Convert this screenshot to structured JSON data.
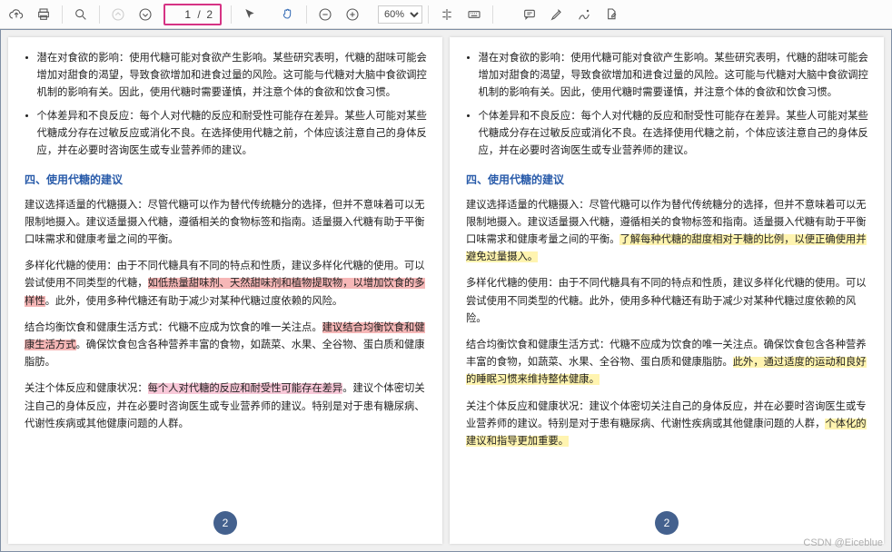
{
  "toolbar": {
    "page_current": "1",
    "page_total": " /  2",
    "zoom_value": "60%"
  },
  "watermark": "CSDN @Eiceblue",
  "page_number_badge": "2",
  "shared": {
    "bullet1": "潜在对食欲的影响：使用代糖可能对食欲产生影响。某些研究表明，代糖的甜味可能会增加对甜食的渴望，导致食欲增加和进食过量的风险。这可能与代糖对大脑中食欲调控机制的影响有关。因此，使用代糖时需要谨慎，并注意个体的食欲和饮食习惯。",
    "bullet2": "个体差异和不良反应：每个人对代糖的反应和耐受性可能存在差异。某些人可能对某些代糖成分存在过敏反应或消化不良。在选择使用代糖之前，个体应该注意自己的身体反应，并在必要时咨询医生或专业营养师的建议。",
    "section_title": "四、使用代糖的建议"
  },
  "left": {
    "p_intake": "建议选择适量的代糖摄入：尽管代糖可以作为替代传统糖分的选择，但并不意味着可以无限制地摄入。建议适量摄入代糖，遵循相关的食物标签和指南。适量摄入代糖有助于平衡口味需求和健康考量之间的平衡。",
    "p_diverse_a": "多样化代糖的使用：由于不同代糖具有不同的特点和性质，建议多样化代糖的使用。可以尝试使用不同类型的代糖，",
    "p_diverse_hl": "如低热量甜味剂、天然甜味剂和植物提取物，以增加饮食的多样性",
    "p_diverse_b": "。此外，使用多种代糖还有助于减少对某种代糖过度依赖的风险。",
    "p_balance_a": "结合均衡饮食和健康生活方式：代糖不应成为饮食的唯一关注点。",
    "p_balance_hl": "建议结合均衡饮食和健康生活方式",
    "p_balance_b": "。确保饮食包含各种营养丰富的食物，如蔬菜、水果、全谷物、蛋白质和健康脂肪。",
    "p_personal_a": "关注个体反应和健康状况：",
    "p_personal_hl": "每个人对代糖的反应和耐受性可能存在差异",
    "p_personal_b": "。建议个体密切关注自己的身体反应，并在必要时咨询医生或专业营养师的建议。特别是对于患有糖尿病、代谢性疾病或其他健康问题的人群。"
  },
  "right": {
    "p_intake_a": "建议选择适量的代糖摄入：尽管代糖可以作为替代传统糖分的选择，但并不意味着可以无限制地摄入。建议适量摄入代糖，遵循相关的食物标签和指南。适量摄入代糖有助于平衡口味需求和健康考量之间的平衡。",
    "p_intake_hl": "了解每种代糖的甜度相对于糖的比例，以便正确使用并避免过量摄入。",
    "p_diverse": "多样化代糖的使用：由于不同代糖具有不同的特点和性质，建议多样化代糖的使用。可以尝试使用不同类型的代糖。此外，使用多种代糖还有助于减少对某种代糖过度依赖的风险。",
    "p_balance_a": "结合均衡饮食和健康生活方式：代糖不应成为饮食的唯一关注点。确保饮食包含各种营养丰富的食物，如蔬菜、水果、全谷物、蛋白质和健康脂肪。",
    "p_balance_hl": "此外，通过适度的运动和良好的睡眠习惯来维持整体健康。",
    "p_personal_a": "关注个体反应和健康状况：建议个体密切关注自己的身体反应，并在必要时咨询医生或专业营养师的建议。特别是对于患有糖尿病、代谢性疾病或其他健康问题的人群，",
    "p_personal_hl": "个体化的建议和指导更加重要。"
  }
}
